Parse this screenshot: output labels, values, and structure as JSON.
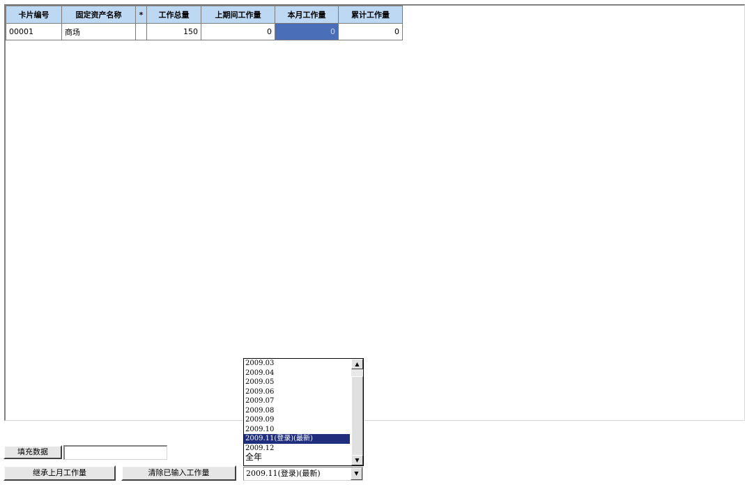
{
  "grid": {
    "headers": [
      "卡片编号",
      "固定资产名称",
      "*",
      "工作总量",
      "上期间工作量",
      "本月工作量",
      "累计工作量"
    ],
    "rows": [
      {
        "card_no": "00001",
        "asset_name": "商场",
        "marker": "",
        "total_work": "150",
        "prev_period_work": "0",
        "this_month_work": "0",
        "cumulative_work": "0"
      }
    ]
  },
  "controls": {
    "fill_data_label": "填充数据",
    "fill_data_value": "",
    "inherit_last_month_label": "继承上月工作量",
    "clear_entered_label": "清除已输入工作量"
  },
  "period_select": {
    "options": [
      "2009.03",
      "2009.04",
      "2009.05",
      "2009.06",
      "2009.07",
      "2009.08",
      "2009.09",
      "2009.10",
      "2009.11(登录)(最新)",
      "2009.12",
      "全年"
    ],
    "selected_index": 8,
    "current_value": "2009.11(登录)(最新)"
  },
  "icons": {
    "scroll_up": "scroll-up-arrow-icon",
    "scroll_down": "scroll-down-arrow-icon",
    "dropdown": "dropdown-arrow-icon"
  },
  "colors": {
    "header_bg": "#bcd8f2",
    "selected_cell_bg": "#4a6fb8",
    "selected_option_bg": "#1f2f7e"
  }
}
